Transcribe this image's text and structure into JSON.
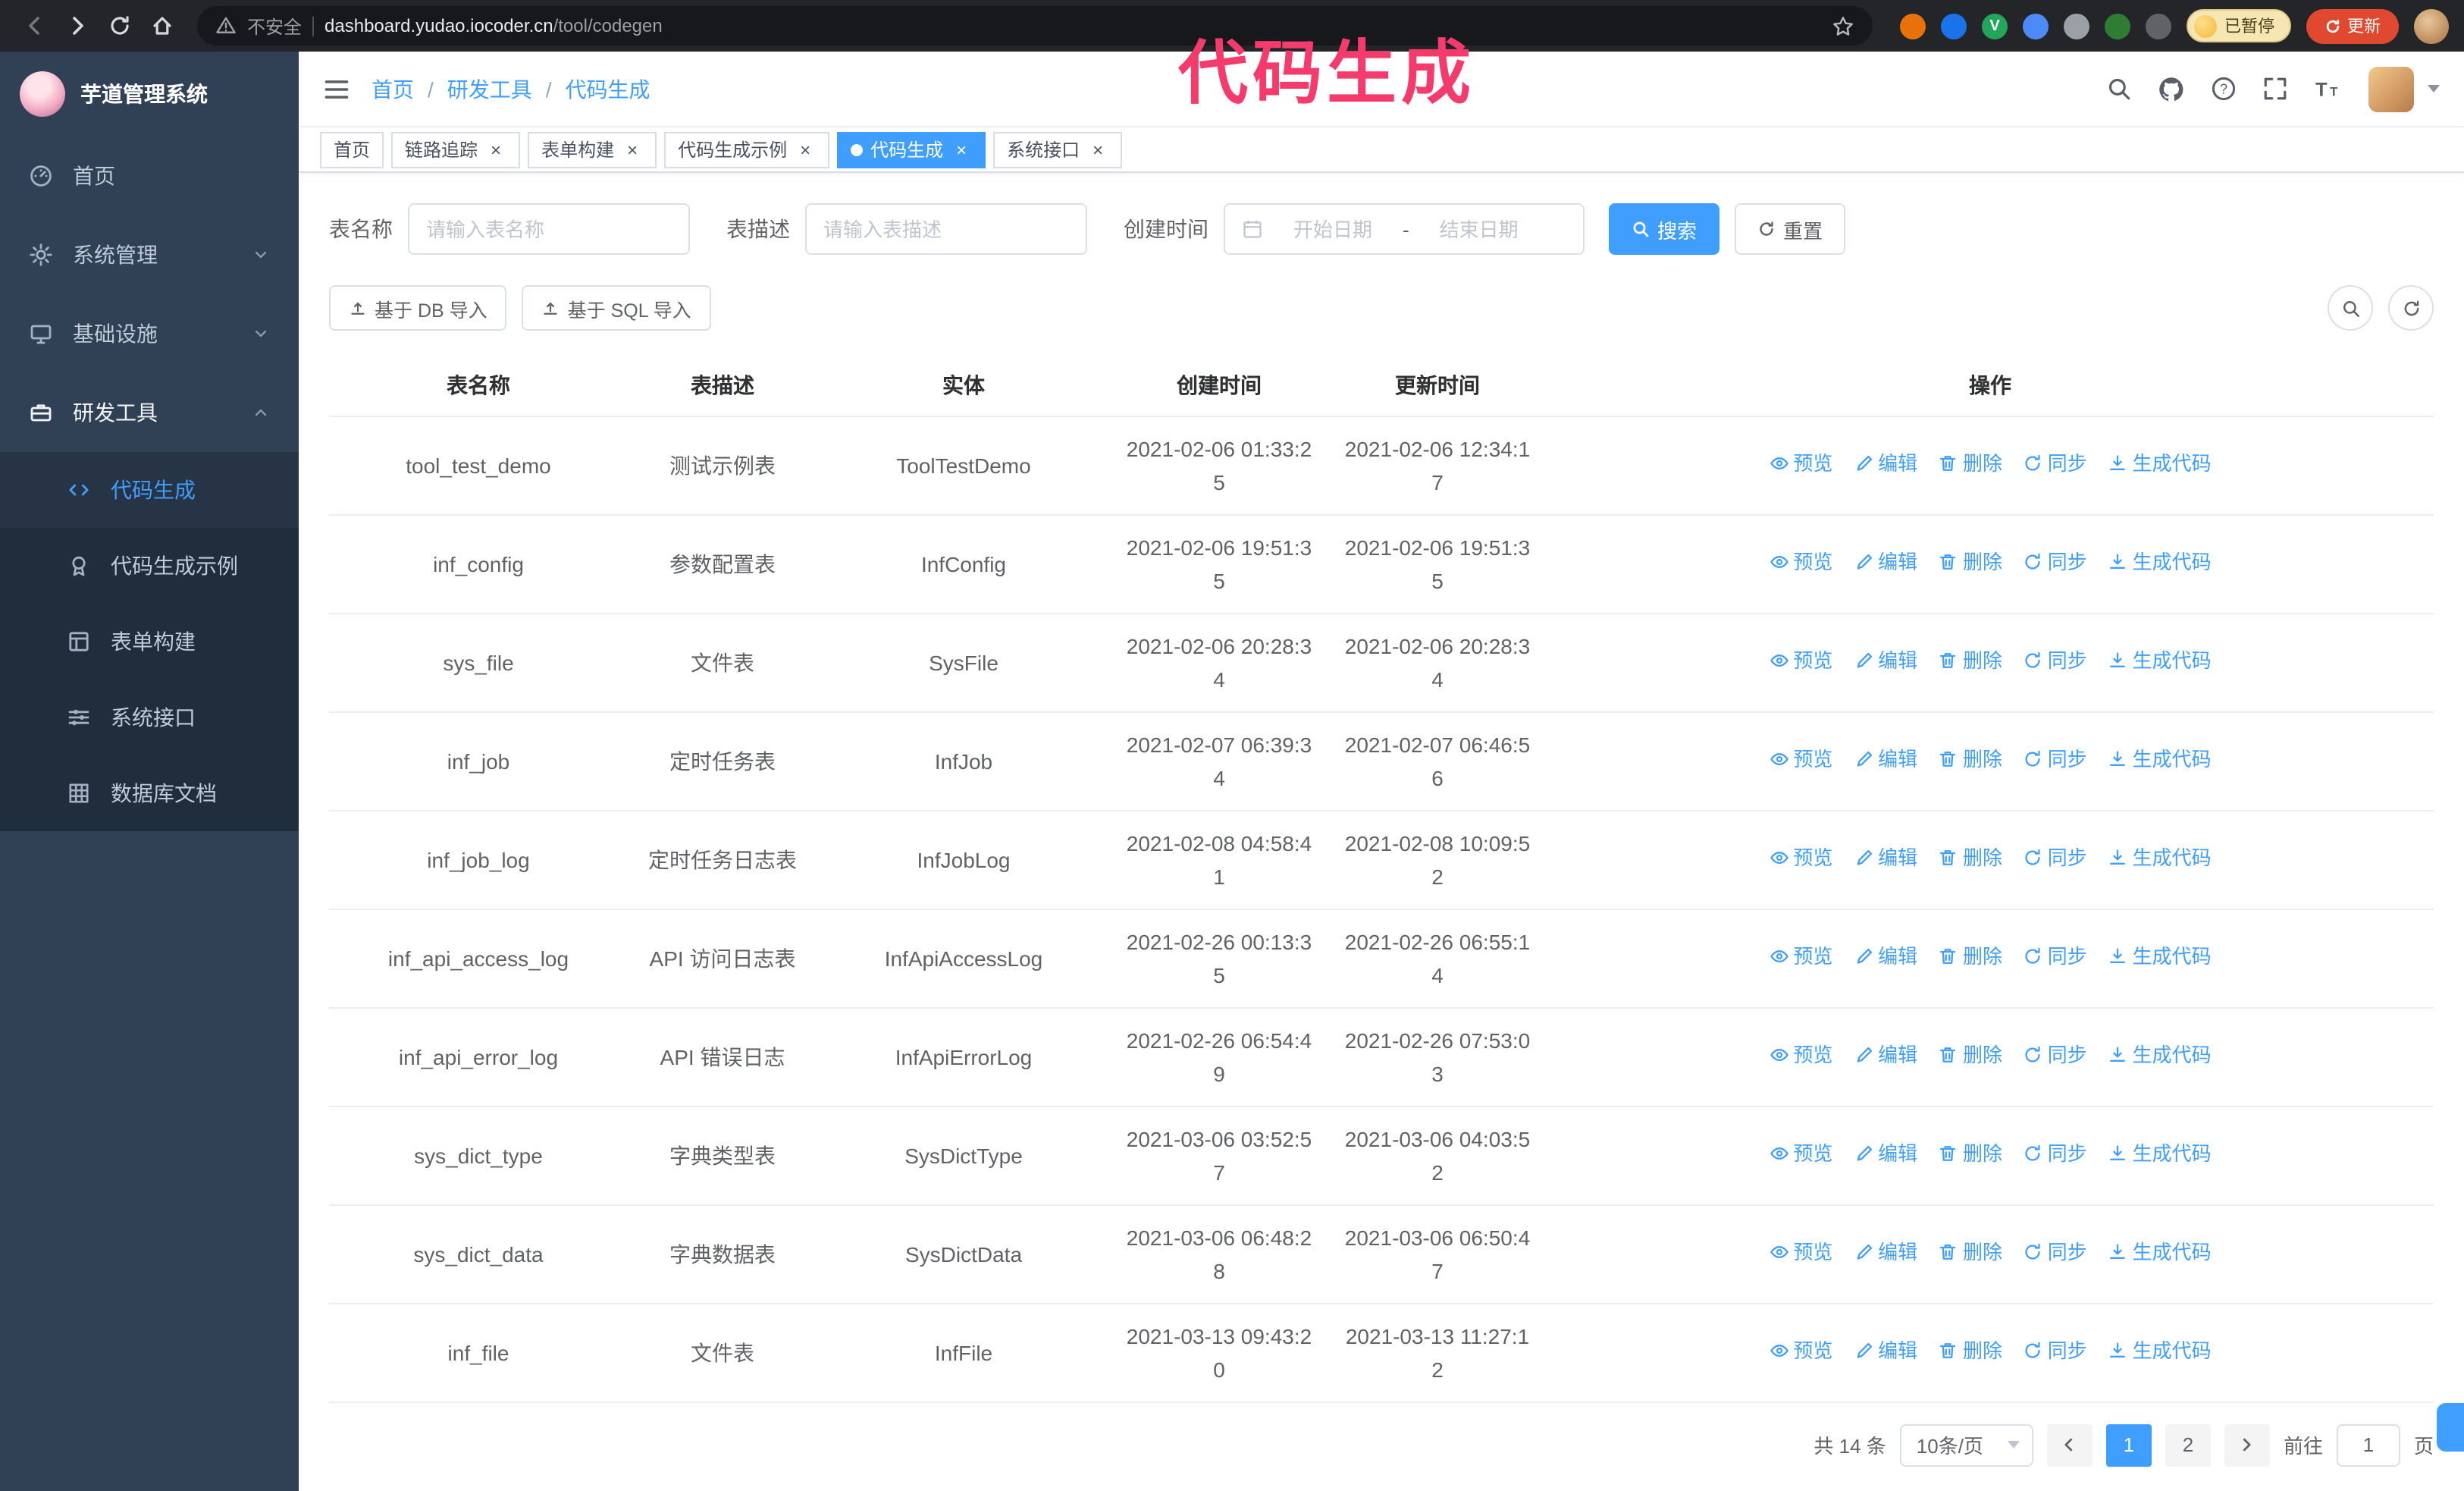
{
  "colors": {
    "primary": "#409eff",
    "sidebar_bg": "#304156",
    "sidebar_sub_bg": "#1f2d3d",
    "annotation": "#f43b6c",
    "update_chip": "#e0492f"
  },
  "annotation": {
    "text": "代码生成"
  },
  "browser": {
    "security_label": "不安全",
    "url_host": "dashboard.yudao.iocoder.cn",
    "url_path": "/tool/codegen",
    "paused_badge": "已暂停",
    "update_button": "更新"
  },
  "sidebar": {
    "logo_title": "芋道管理系统",
    "menu": [
      {
        "label": "首页"
      },
      {
        "label": "系统管理"
      },
      {
        "label": "基础设施"
      },
      {
        "label": "研发工具"
      }
    ],
    "submenu": [
      {
        "label": "代码生成"
      },
      {
        "label": "代码生成示例"
      },
      {
        "label": "表单构建"
      },
      {
        "label": "系统接口"
      },
      {
        "label": "数据库文档"
      }
    ]
  },
  "breadcrumb": {
    "separator": "/",
    "items": [
      "首页",
      "研发工具",
      "代码生成"
    ]
  },
  "tabs": {
    "close_glyph": "×",
    "active_index": 4,
    "items": [
      {
        "label": "首页"
      },
      {
        "label": "链路追踪"
      },
      {
        "label": "表单构建"
      },
      {
        "label": "代码生成示例"
      },
      {
        "label": "代码生成"
      },
      {
        "label": "系统接口"
      }
    ]
  },
  "filters": {
    "name_label": "表名称",
    "name_placeholder": "请输入表名称",
    "desc_label": "表描述",
    "desc_placeholder": "请输入表描述",
    "time_label": "创建时间",
    "start_placeholder": "开始日期",
    "range_separator": "-",
    "end_placeholder": "结束日期",
    "search_label": "搜索",
    "reset_label": "重置"
  },
  "toolbar": {
    "import_db_label": "基于 DB 导入",
    "import_sql_label": "基于 SQL 导入"
  },
  "table": {
    "columns": [
      "表名称",
      "表描述",
      "实体",
      "创建时间",
      "更新时间",
      "操作"
    ],
    "row_actions": [
      {
        "name": "preview-action",
        "icon": "eye",
        "label": "预览"
      },
      {
        "name": "edit-action",
        "icon": "edit",
        "label": "编辑"
      },
      {
        "name": "delete-action",
        "icon": "trash",
        "label": "删除"
      },
      {
        "name": "sync-action",
        "icon": "sync",
        "label": "同步"
      },
      {
        "name": "generate-code-action",
        "icon": "download",
        "label": "生成代码"
      }
    ],
    "rows": [
      {
        "name": "tool_test_demo",
        "description": "测试示例表",
        "entity": "ToolTestDemo",
        "create_time": "2021-02-06 01:33:25",
        "update_time": "2021-02-06 12:34:17"
      },
      {
        "name": "inf_config",
        "description": "参数配置表",
        "entity": "InfConfig",
        "create_time": "2021-02-06 19:51:35",
        "update_time": "2021-02-06 19:51:35"
      },
      {
        "name": "sys_file",
        "description": "文件表",
        "entity": "SysFile",
        "create_time": "2021-02-06 20:28:34",
        "update_time": "2021-02-06 20:28:34"
      },
      {
        "name": "inf_job",
        "description": "定时任务表",
        "entity": "InfJob",
        "create_time": "2021-02-07 06:39:34",
        "update_time": "2021-02-07 06:46:56"
      },
      {
        "name": "inf_job_log",
        "description": "定时任务日志表",
        "entity": "InfJobLog",
        "create_time": "2021-02-08 04:58:41",
        "update_time": "2021-02-08 10:09:52"
      },
      {
        "name": "inf_api_access_log",
        "description": "API 访问日志表",
        "entity": "InfApiAccessLog",
        "create_time": "2021-02-26 00:13:35",
        "update_time": "2021-02-26 06:55:14"
      },
      {
        "name": "inf_api_error_log",
        "description": "API 错误日志",
        "entity": "InfApiErrorLog",
        "create_time": "2021-02-26 06:54:49",
        "update_time": "2021-02-26 07:53:03"
      },
      {
        "name": "sys_dict_type",
        "description": "字典类型表",
        "entity": "SysDictType",
        "create_time": "2021-03-06 03:52:57",
        "update_time": "2021-03-06 04:03:52"
      },
      {
        "name": "sys_dict_data",
        "description": "字典数据表",
        "entity": "SysDictData",
        "create_time": "2021-03-06 06:48:28",
        "update_time": "2021-03-06 06:50:47"
      },
      {
        "name": "inf_file",
        "description": "文件表",
        "entity": "InfFile",
        "create_time": "2021-03-13 09:43:20",
        "update_time": "2021-03-13 11:27:12"
      }
    ]
  },
  "pagination": {
    "total_label": "共 14 条",
    "page_size_label": "10条/页",
    "pages": [
      "1",
      "2"
    ],
    "active_page": "1",
    "goto_prefix": "前往",
    "goto_value": "1",
    "goto_suffix": "页"
  }
}
